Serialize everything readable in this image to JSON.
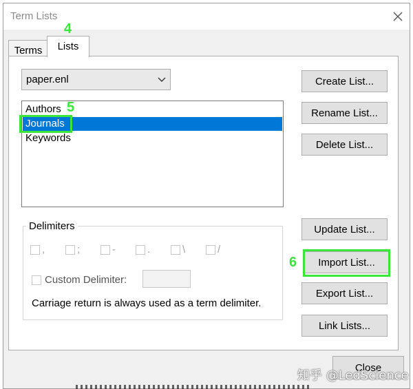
{
  "window": {
    "title": "Term Lists"
  },
  "tabs": [
    {
      "label": "Terms"
    },
    {
      "label": "Lists"
    }
  ],
  "file_select": {
    "value": "paper.enl"
  },
  "lists": {
    "items": [
      "Authors",
      "Journals",
      "Keywords"
    ],
    "selected": "Journals"
  },
  "buttons": {
    "create": "Create List...",
    "rename": "Rename List...",
    "delete": "Delete List...",
    "update": "Update List...",
    "import": "Import List...",
    "export": "Export List...",
    "link": "Link Lists...",
    "close": "Close"
  },
  "delimiters": {
    "legend": "Delimiters",
    "options": [
      ",",
      ";",
      "-",
      ".",
      "\\",
      "/"
    ],
    "custom_label": "Custom Delimiter:",
    "custom_value": "",
    "note": "Carriage return is always used as a term delimiter."
  },
  "annotations": {
    "step4": "4",
    "step5": "5",
    "step6": "6",
    "color": "#39e639"
  },
  "watermark": "知乎 @LedScience"
}
